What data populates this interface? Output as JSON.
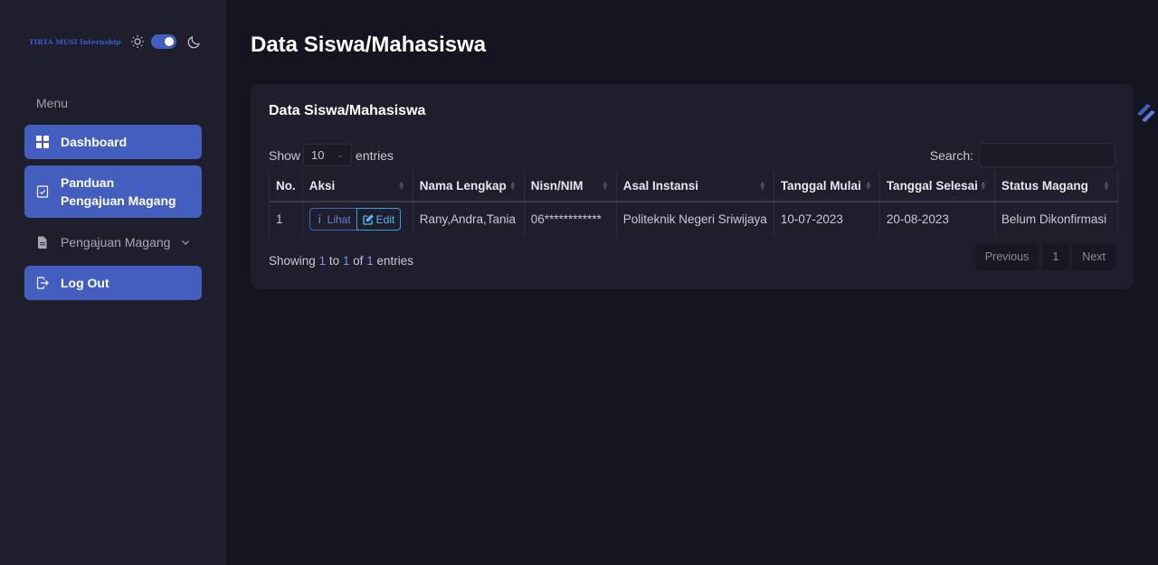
{
  "sidebar": {
    "logo": "TIRTA MUSI Internship",
    "menu_title": "Menu",
    "items": [
      {
        "label": "Dashboard"
      },
      {
        "label": "Panduan Pengajuan Magang"
      },
      {
        "label": "Pengajuan Magang"
      },
      {
        "label": "Log Out"
      }
    ]
  },
  "page_title": "Data Siswa/Mahasiswa",
  "card": {
    "title": "Data Siswa/Mahasiswa",
    "show_label": "Show",
    "entries_value": "10",
    "entries_label": "entries",
    "search_label": "Search:",
    "search_value": "",
    "columns": [
      "No.",
      "Aksi",
      "Nama Lengkap",
      "Nisn/NIM",
      "Asal Instansi",
      "Tanggal Mulai",
      "Tanggal Selesai",
      "Status Magang"
    ],
    "rows": [
      {
        "no": "1",
        "lihat_label": "Lihat",
        "edit_label": "Edit",
        "nama": "Rany,Andra,Tania",
        "nim": "06************",
        "instansi": "Politeknik Negeri Sriwijaya",
        "mulai": "10-07-2023",
        "selesai": "20-08-2023",
        "status": "Belum Dikonfirmasi"
      }
    ],
    "info": {
      "prefix": "Showing",
      "from": "1",
      "to_word": "to",
      "to": "1",
      "of_word": "of",
      "total": "1",
      "suffix": "entries"
    },
    "pager": {
      "previous": "Previous",
      "page": "1",
      "next": "Next"
    }
  },
  "colors": {
    "accent": "#435ebe",
    "background": "#151521",
    "surface": "#1e1e2d"
  }
}
